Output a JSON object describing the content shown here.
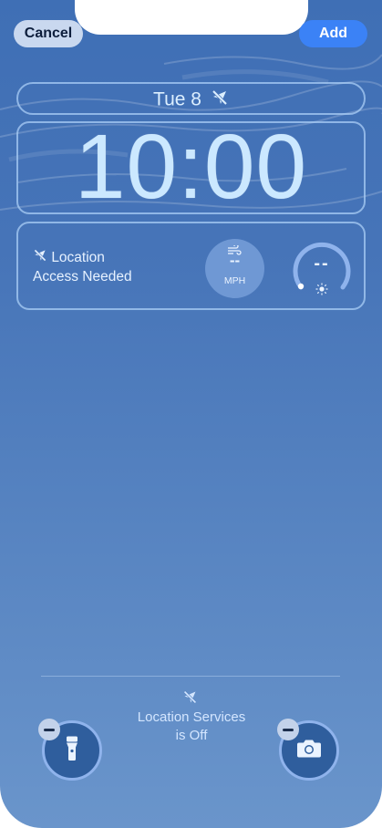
{
  "toolbar": {
    "cancel_label": "Cancel",
    "add_label": "Add"
  },
  "lockscreen": {
    "date": "Tue 8",
    "time": "10:00"
  },
  "widgets": {
    "location_line1": "Location",
    "location_line2": "Access Needed",
    "wind_value": "--",
    "wind_unit": "MPH",
    "uv_value": "--"
  },
  "footer": {
    "location_services_line1": "Location Services",
    "location_services_line2": "is Off"
  },
  "quick_actions": {
    "left_icon": "flashlight-icon",
    "right_icon": "camera-icon"
  },
  "colors": {
    "add_button": "#3b82f6",
    "cancel_button": "#c9d8ef",
    "widget_border": "#aacdf5"
  }
}
